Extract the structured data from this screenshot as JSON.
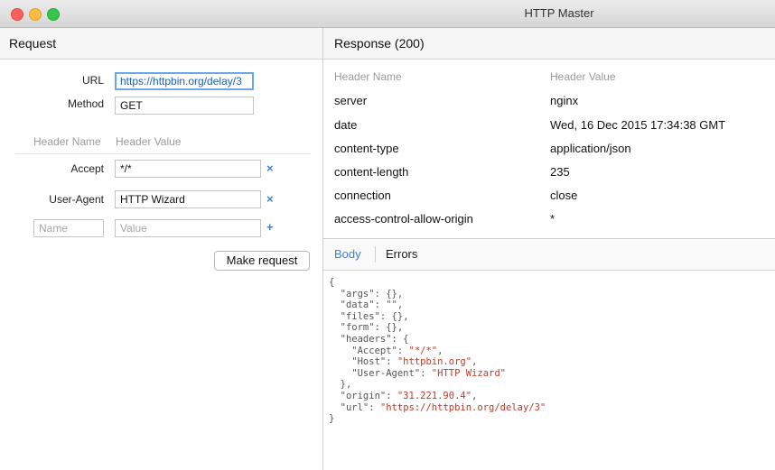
{
  "window": {
    "title": "HTTP Master"
  },
  "request": {
    "header": "Request",
    "url_label": "URL",
    "url_value": "https://httpbin.org/delay/3",
    "method_label": "Method",
    "method_value": "GET",
    "col_name": "Header Name",
    "col_value": "Header Value",
    "headers": [
      {
        "name": "Accept",
        "value": "*/*",
        "action": "×"
      },
      {
        "name": "User-Agent",
        "value": "HTTP Wizard",
        "action": "×"
      }
    ],
    "new_name_placeholder": "Name",
    "new_value_placeholder": "Value",
    "add_symbol": "+",
    "submit_label": "Make request"
  },
  "response": {
    "header": "Response (200)",
    "col_name": "Header Name",
    "col_value": "Header Value",
    "headers": [
      {
        "name": "server",
        "value": "nginx"
      },
      {
        "name": "date",
        "value": "Wed, 16 Dec 2015 17:34:38 GMT"
      },
      {
        "name": "content-type",
        "value": "application/json"
      },
      {
        "name": "content-length",
        "value": "235"
      },
      {
        "name": "connection",
        "value": "close"
      },
      {
        "name": "access-control-allow-origin",
        "value": "*"
      }
    ],
    "tabs": [
      {
        "label": "Body",
        "active": true
      },
      {
        "label": "Errors",
        "active": false
      }
    ],
    "body": {
      "args": "{}",
      "data": "\"\"",
      "files": "{}",
      "form": "{}",
      "header_accept": "\"*/*\"",
      "header_host": "\"httpbin.org\"",
      "header_user_agent": "\"HTTP Wizard\"",
      "origin": "\"31.221.90.4\"",
      "url": "\"https://httpbin.org/delay/3\""
    }
  },
  "colors": {
    "accent": "#3b7fd6",
    "json_string": "#c0392b"
  }
}
